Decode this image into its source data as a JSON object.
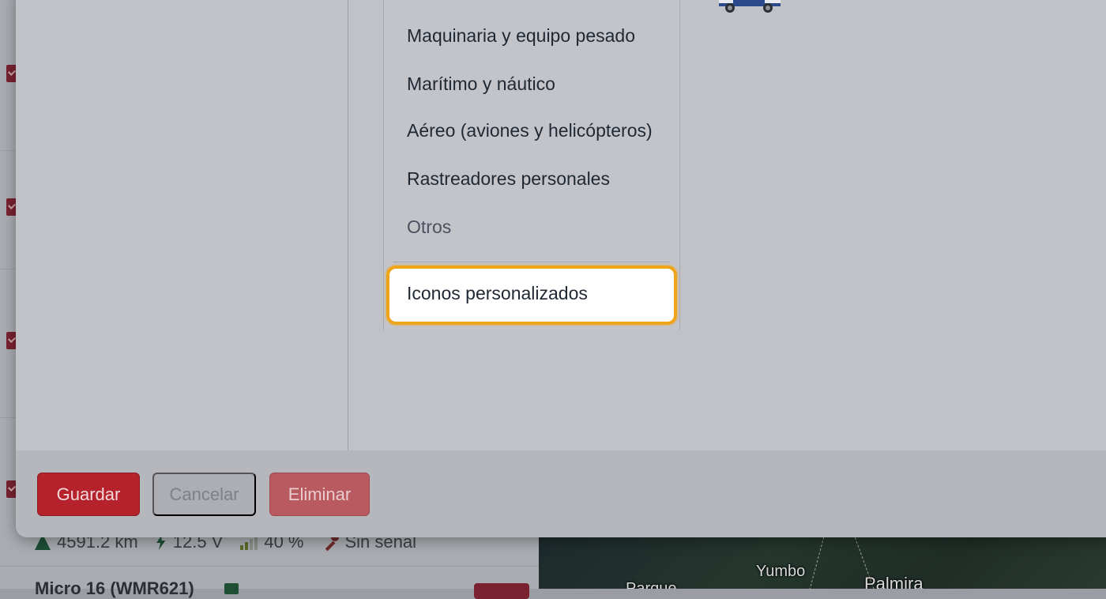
{
  "dropdown": {
    "items": [
      "Maquinaria y equipo pesado",
      "Marítimo y náutico",
      "Aéreo (aviones y helicópteros)",
      "Rastreadores personales",
      "Otros"
    ],
    "highlighted": "Iconos personalizados"
  },
  "footer": {
    "save_label": "Guardar",
    "cancel_label": "Cancelar",
    "delete_label": "Eliminar"
  },
  "background": {
    "odometer": "4591.2 km",
    "voltage": "12.5 V",
    "signal": "40 %",
    "ignition": "Sin señal",
    "next_vehicle": "Micro 16 (WMR621)"
  },
  "map": {
    "labels": [
      "Yumbo",
      "Palmira",
      "Parque"
    ]
  },
  "colors": {
    "accent": "#b5222c",
    "highlight_border": "#f0a41a"
  }
}
